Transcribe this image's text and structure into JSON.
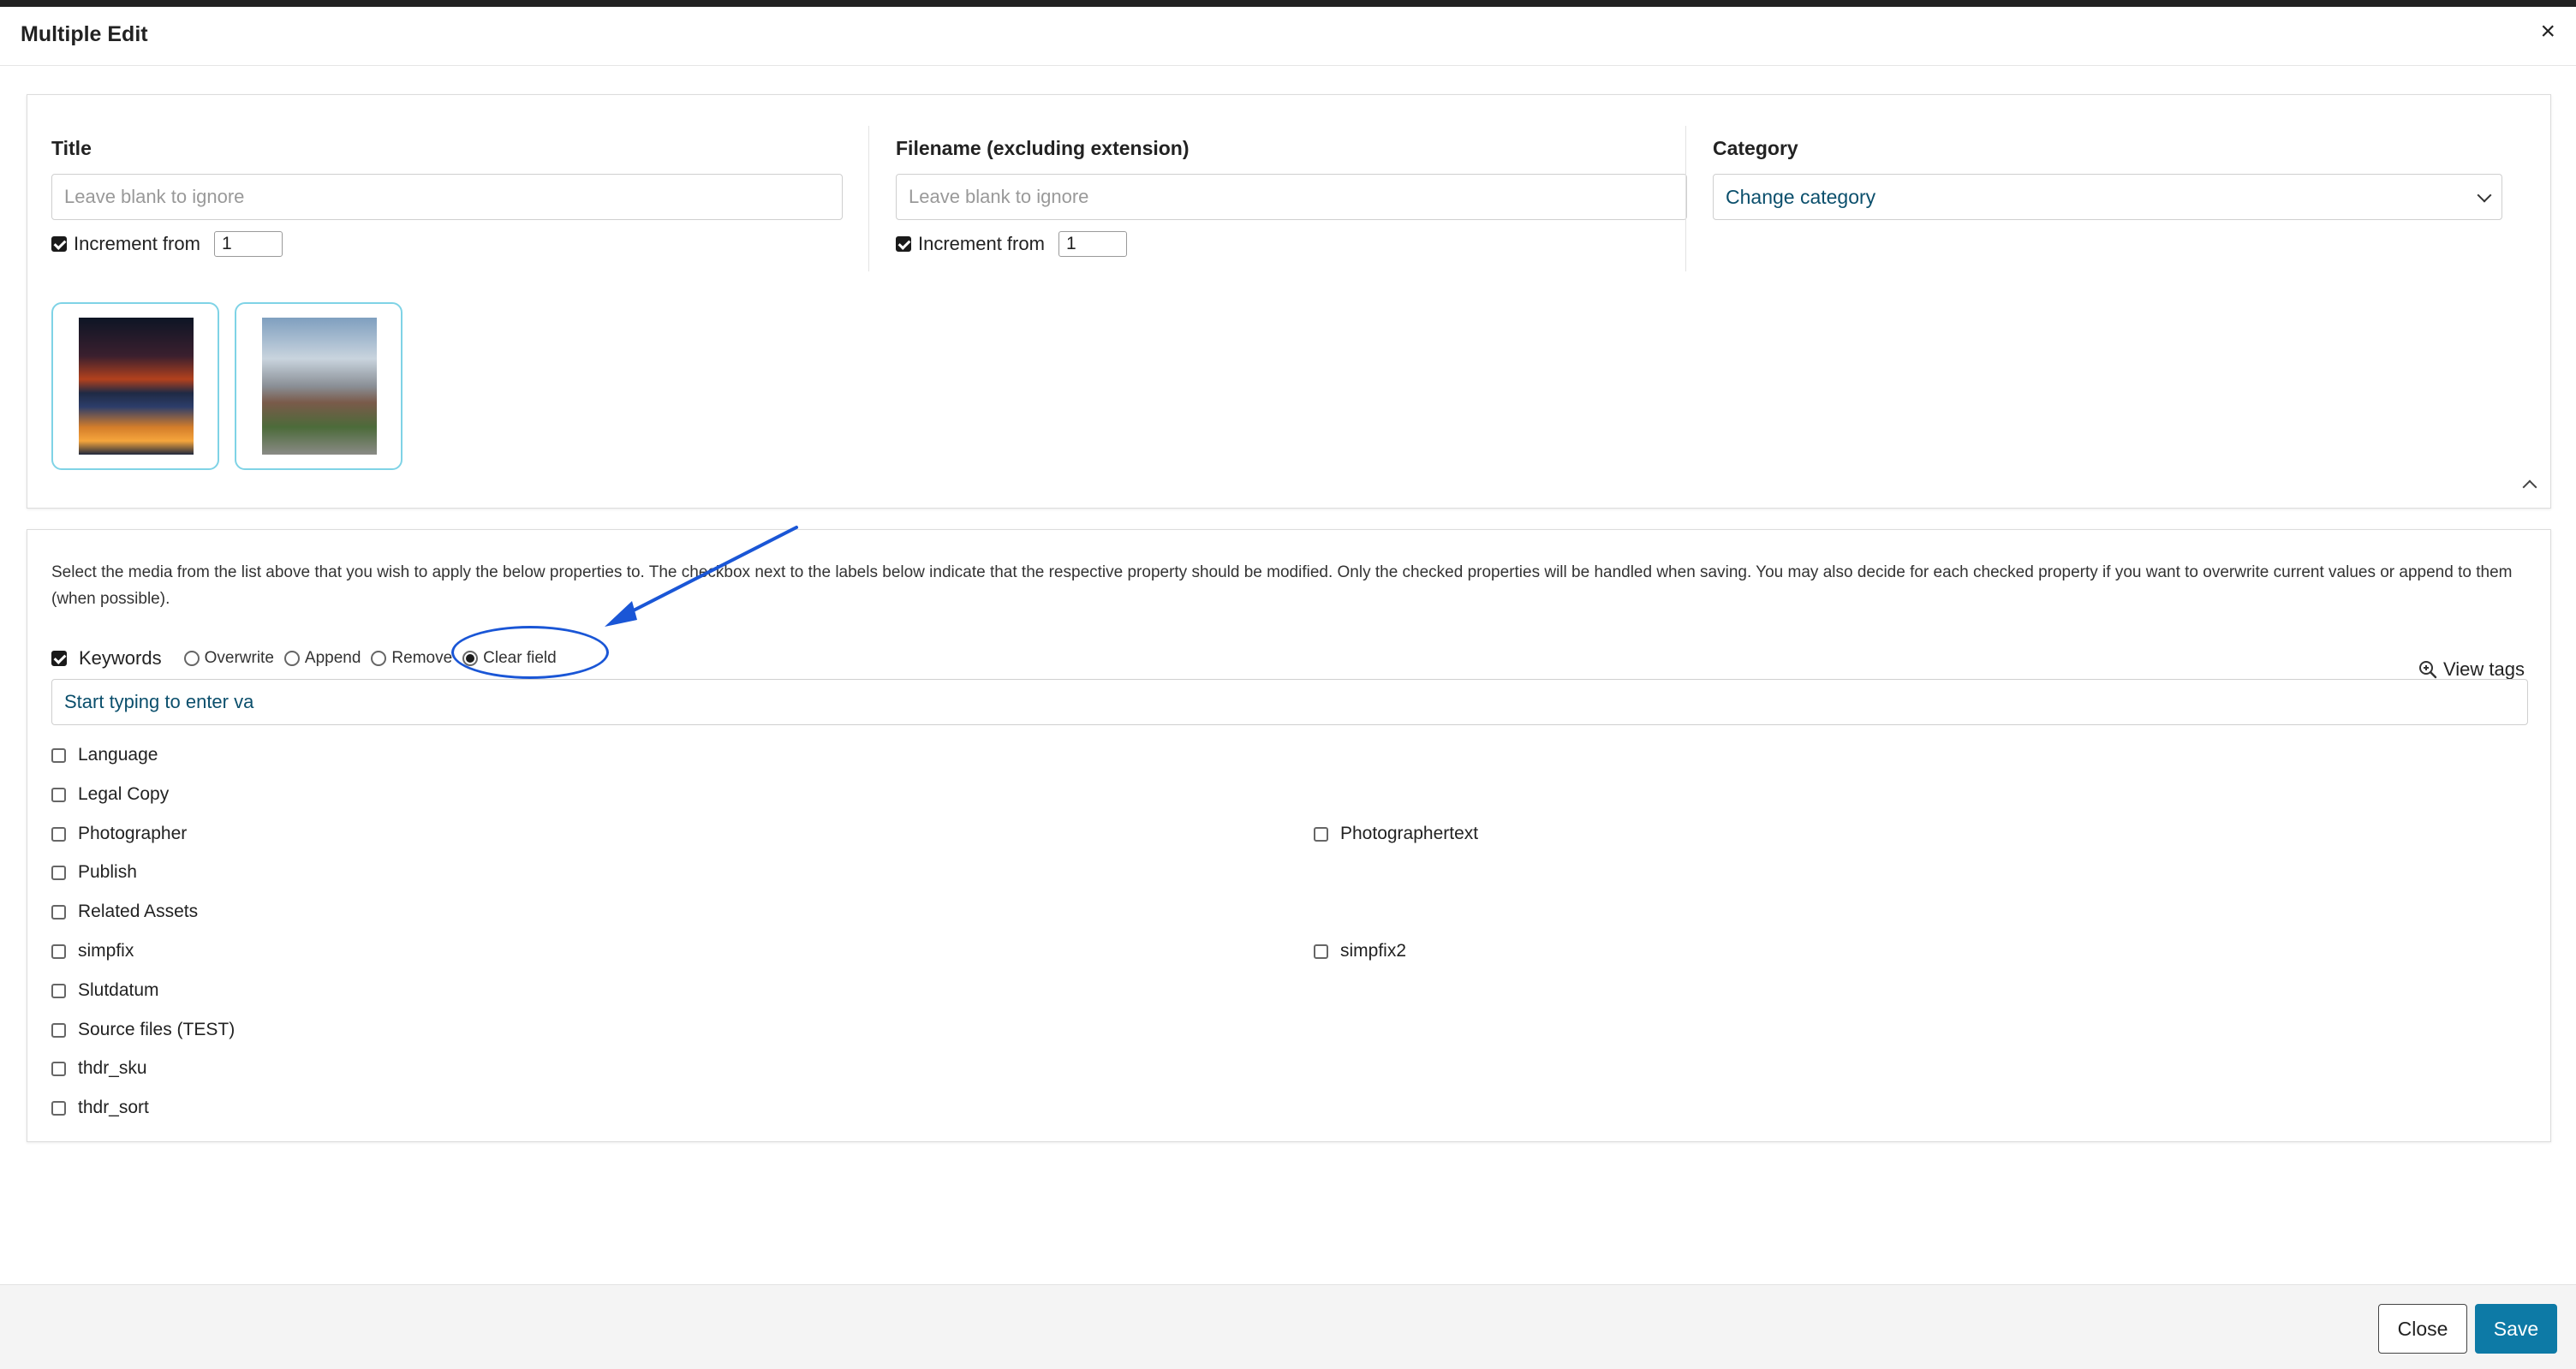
{
  "modal": {
    "title": "Multiple Edit"
  },
  "top_panel": {
    "title_field": {
      "label": "Title",
      "placeholder": "Leave blank to ignore",
      "increment_label": "Increment from",
      "increment_value": "1",
      "increment_checked": true
    },
    "filename_field": {
      "label": "Filename (excluding extension)",
      "placeholder": "Leave blank to ignore",
      "increment_label": "Increment from",
      "increment_value": "1",
      "increment_checked": true
    },
    "category_field": {
      "label": "Category",
      "selected": "Change category"
    },
    "thumbnails": [
      {
        "icon": "night-city-photo"
      },
      {
        "icon": "building-street-photo"
      }
    ]
  },
  "bottom_panel": {
    "info_text": "Select the media from the list above that you wish to apply the below properties to. The checkbox next to the labels below indicate that the respective property should be modified. Only the checked properties will be handled when saving. You may also decide for each checked property if you want to overwrite current values or append to them (when possible).",
    "keywords": {
      "label": "Keywords",
      "checked": true,
      "options": [
        "Overwrite",
        "Append",
        "Remove",
        "Clear field"
      ],
      "selected_option": "Clear field",
      "view_tags": "View tags",
      "input_value": "Start typing to enter va"
    },
    "properties": [
      {
        "label": "Language",
        "checked": false
      },
      {
        "label": "Legal Copy",
        "checked": false
      },
      {
        "label": "Photographer",
        "checked": false
      },
      {
        "label": "Photographertext",
        "checked": false
      },
      {
        "label": "Publish",
        "checked": false
      },
      {
        "label": "Related Assets",
        "checked": false
      },
      {
        "label": "simpfix",
        "checked": false
      },
      {
        "label": "simpfix2",
        "checked": false
      },
      {
        "label": "Slutdatum",
        "checked": false
      },
      {
        "label": "Source files (TEST)",
        "checked": false
      },
      {
        "label": "thdr_sku",
        "checked": false
      },
      {
        "label": "thdr_sort",
        "checked": false
      }
    ]
  },
  "footer": {
    "close_label": "Close",
    "save_label": "Save"
  },
  "colors": {
    "accent": "#0d7aa6",
    "annotation": "#1a56d6",
    "thumb_border": "#7fd3e6",
    "link_text": "#0b4f6c"
  }
}
